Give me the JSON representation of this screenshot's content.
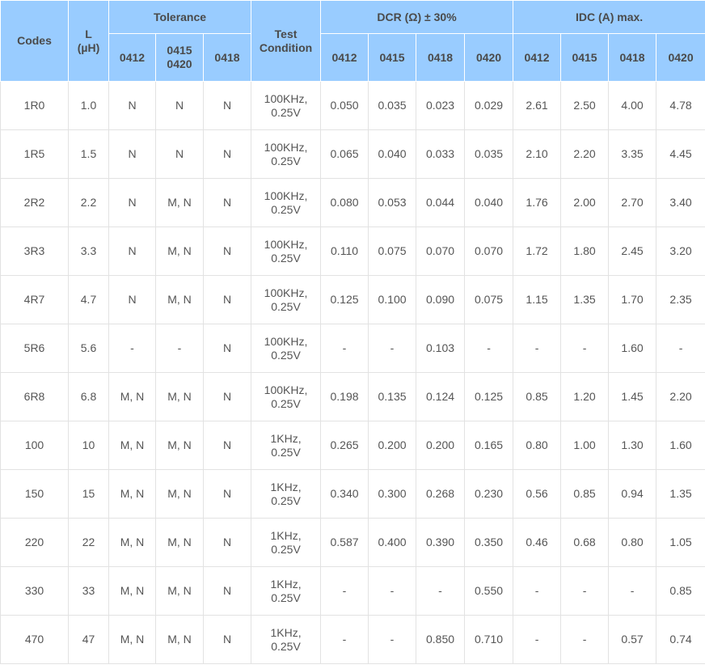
{
  "headers": {
    "codes": "Codes",
    "inductance_line1": "L",
    "inductance_line2": "(µH)",
    "tolerance": "Tolerance",
    "test_line1": "Test",
    "test_line2": "Condition",
    "dcr": "DCR (Ω) ± 30%",
    "idc": "IDC (A) max.",
    "tol_sub": [
      "0412",
      "0415\n0420",
      "0418"
    ],
    "dcr_sub": [
      "0412",
      "0415",
      "0418",
      "0420"
    ],
    "idc_sub": [
      "0412",
      "0415",
      "0418",
      "0420"
    ]
  },
  "rows": [
    {
      "code": "1R0",
      "l": "1.0",
      "tol": [
        "N",
        "N",
        "N"
      ],
      "test": "100KHz,\n0.25V",
      "dcr": [
        "0.050",
        "0.035",
        "0.023",
        "0.029"
      ],
      "idc": [
        "2.61",
        "2.50",
        "4.00",
        "4.78"
      ]
    },
    {
      "code": "1R5",
      "l": "1.5",
      "tol": [
        "N",
        "N",
        "N"
      ],
      "test": "100KHz,\n0.25V",
      "dcr": [
        "0.065",
        "0.040",
        "0.033",
        "0.035"
      ],
      "idc": [
        "2.10",
        "2.20",
        "3.35",
        "4.45"
      ]
    },
    {
      "code": "2R2",
      "l": "2.2",
      "tol": [
        "N",
        "M, N",
        "N"
      ],
      "test": "100KHz,\n0.25V",
      "dcr": [
        "0.080",
        "0.053",
        "0.044",
        "0.040"
      ],
      "idc": [
        "1.76",
        "2.00",
        "2.70",
        "3.40"
      ]
    },
    {
      "code": "3R3",
      "l": "3.3",
      "tol": [
        "N",
        "M, N",
        "N"
      ],
      "test": "100KHz,\n0.25V",
      "dcr": [
        "0.110",
        "0.075",
        "0.070",
        "0.070"
      ],
      "idc": [
        "1.72",
        "1.80",
        "2.45",
        "3.20"
      ]
    },
    {
      "code": "4R7",
      "l": "4.7",
      "tol": [
        "N",
        "M, N",
        "N"
      ],
      "test": "100KHz,\n0.25V",
      "dcr": [
        "0.125",
        "0.100",
        "0.090",
        "0.075"
      ],
      "idc": [
        "1.15",
        "1.35",
        "1.70",
        "2.35"
      ]
    },
    {
      "code": "5R6",
      "l": "5.6",
      "tol": [
        "-",
        "-",
        "N"
      ],
      "test": "100KHz,\n0.25V",
      "dcr": [
        "-",
        "-",
        "0.103",
        "-"
      ],
      "idc": [
        "-",
        "-",
        "1.60",
        "-"
      ]
    },
    {
      "code": "6R8",
      "l": "6.8",
      "tol": [
        "M, N",
        "M, N",
        "N"
      ],
      "test": "100KHz,\n0.25V",
      "dcr": [
        "0.198",
        "0.135",
        "0.124",
        "0.125"
      ],
      "idc": [
        "0.85",
        "1.20",
        "1.45",
        "2.20"
      ]
    },
    {
      "code": "100",
      "l": "10",
      "tol": [
        "M, N",
        "M, N",
        "N"
      ],
      "test": "1KHz,\n0.25V",
      "dcr": [
        "0.265",
        "0.200",
        "0.200",
        "0.165"
      ],
      "idc": [
        "0.80",
        "1.00",
        "1.30",
        "1.60"
      ]
    },
    {
      "code": "150",
      "l": "15",
      "tol": [
        "M, N",
        "M, N",
        "N"
      ],
      "test": "1KHz,\n0.25V",
      "dcr": [
        "0.340",
        "0.300",
        "0.268",
        "0.230"
      ],
      "idc": [
        "0.56",
        "0.85",
        "0.94",
        "1.35"
      ]
    },
    {
      "code": "220",
      "l": "22",
      "tol": [
        "M, N",
        "M, N",
        "N"
      ],
      "test": "1KHz,\n0.25V",
      "dcr": [
        "0.587",
        "0.400",
        "0.390",
        "0.350"
      ],
      "idc": [
        "0.46",
        "0.68",
        "0.80",
        "1.05"
      ]
    },
    {
      "code": "330",
      "l": "33",
      "tol": [
        "M, N",
        "M, N",
        "N"
      ],
      "test": "1KHz,\n0.25V",
      "dcr": [
        "-",
        "-",
        "-",
        "0.550"
      ],
      "idc": [
        "-",
        "-",
        "-",
        "0.85"
      ]
    },
    {
      "code": "470",
      "l": "47",
      "tol": [
        "M, N",
        "M, N",
        "N"
      ],
      "test": "1KHz,\n0.25V",
      "dcr": [
        "-",
        "-",
        "0.850",
        "0.710"
      ],
      "idc": [
        "-",
        "-",
        "0.57",
        "0.74"
      ]
    }
  ]
}
